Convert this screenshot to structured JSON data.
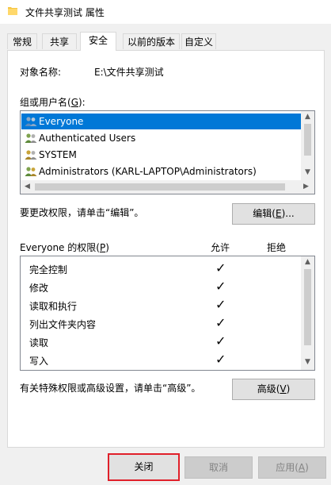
{
  "window": {
    "title": "文件共享测试 属性"
  },
  "tabs": [
    "常规",
    "共享",
    "安全",
    "以前的版本",
    "自定义"
  ],
  "security": {
    "object_label": "对象名称:",
    "object_value": "E:\\文件共享测试",
    "group_label_pre": "组或用户名(",
    "group_label_key": "G",
    "group_label_post": "):",
    "users": [
      "Everyone",
      "Authenticated Users",
      "SYSTEM",
      "Administrators (KARL-LAPTOP\\Administrators)"
    ],
    "change_hint": "要更改权限，请单击“编辑”。",
    "edit_pre": "编辑(",
    "edit_key": "E",
    "edit_post": ")...",
    "perm_header_pre": "Everyone 的权限(",
    "perm_header_key": "P",
    "perm_header_post": ")",
    "allow_label": "允许",
    "deny_label": "拒绝",
    "permissions": [
      "完全控制",
      "修改",
      "读取和执行",
      "列出文件夹内容",
      "读取",
      "写入"
    ],
    "advanced_hint": "有关特殊权限或高级设置，请单击“高级”。",
    "advanced_pre": "高级(",
    "advanced_key": "V",
    "advanced_post": ")"
  },
  "footer": {
    "close": "关闭",
    "cancel": "取消",
    "apply_pre": "应用(",
    "apply_key": "A",
    "apply_post": ")"
  },
  "icons": {
    "check": "✓",
    "up": "▲",
    "down": "▼",
    "left": "◀",
    "right": "▶"
  }
}
